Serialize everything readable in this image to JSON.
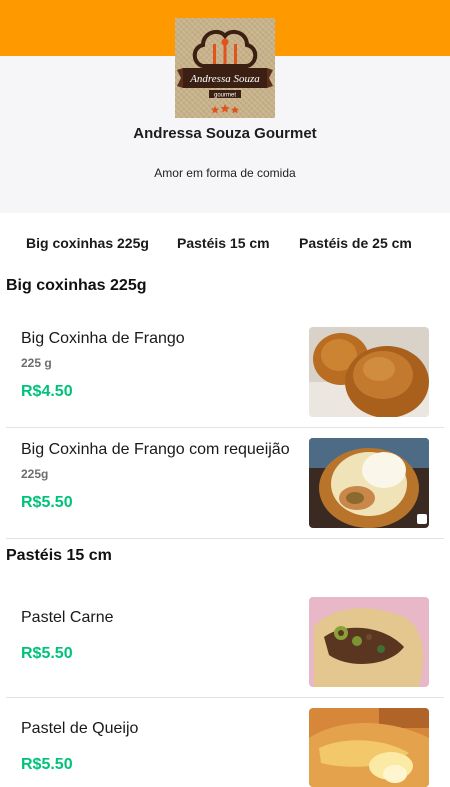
{
  "colors": {
    "brand": "#ff9900",
    "price": "#00c27a",
    "header_bg": "#f6f6f9"
  },
  "store": {
    "logo_text": "Andressa Souza",
    "logo_subtext": "gourmet",
    "name": "Andressa Souza Gourmet",
    "tagline": "Amor em forma de comida"
  },
  "category_tabs": [
    "Big coxinhas 225g",
    "Pastéis 15 cm",
    "Pastéis de 25 cm"
  ],
  "sections": [
    {
      "title": "Big coxinhas 225g",
      "items": [
        {
          "name": "Big Coxinha de Frango",
          "description": "225 g",
          "price": "R$4.50",
          "image_icon": "fried-coxinha-photo"
        },
        {
          "name": "Big Coxinha de Frango com requeijão",
          "description": "225g",
          "price": "R$5.50",
          "image_icon": "cut-coxinha-photo"
        }
      ]
    },
    {
      "title": "Pastéis 15 cm",
      "items": [
        {
          "name": "Pastel Carne",
          "description": "",
          "price": "R$5.50",
          "image_icon": "meat-pastel-photo"
        },
        {
          "name": "Pastel de Queijo",
          "description": "",
          "price": "R$5.50",
          "image_icon": "cheese-pastel-photo"
        }
      ]
    }
  ]
}
